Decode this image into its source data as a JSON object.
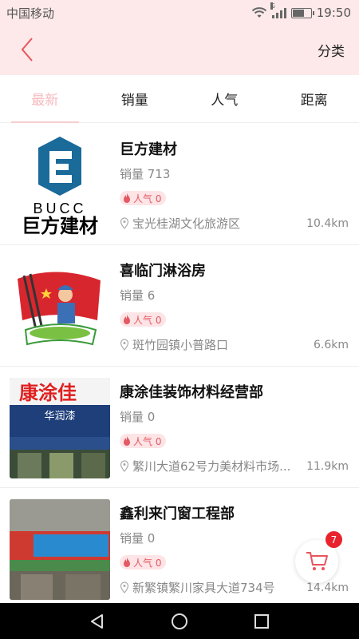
{
  "status_bar": {
    "carrier": "中国移动",
    "network": "G",
    "time": "19:50",
    "battery_level": 0.7
  },
  "header": {
    "back_icon": "chevron-left-icon",
    "category_label": "分类"
  },
  "tabs": [
    {
      "label": "最新",
      "active": true
    },
    {
      "label": "销量",
      "active": false
    },
    {
      "label": "人气",
      "active": false
    },
    {
      "label": "距离",
      "active": false
    }
  ],
  "shops": [
    {
      "name": "巨方建材",
      "sales": "销量 713",
      "popularity": "人气 0",
      "address": "宝光桂湖文化旅游区",
      "distance": "10.4km",
      "logo_text": "BUCC",
      "logo_subtext": "巨方建材"
    },
    {
      "name": "喜临门淋浴房",
      "sales": "销量 6",
      "popularity": "人气 0",
      "address": "斑竹园镇小普路口",
      "distance": "6.6km"
    },
    {
      "name": "康涂佳装饰材料经营部",
      "sales": "销量 0",
      "popularity": "人气 0",
      "address": "繁川大道62号力美材料市场...",
      "distance": "11.9km",
      "sign_text": "康涂佳",
      "sign_sub": "华润漆"
    },
    {
      "name": "鑫利来门窗工程部",
      "sales": "销量 0",
      "popularity": "人气 0",
      "address": "新繁镇繁川家具大道734号",
      "distance": "14.4km"
    }
  ],
  "cart": {
    "count": "7",
    "icon": "cart-icon"
  },
  "colors": {
    "accent": "#e8232e",
    "header_bg": "#fde9ea",
    "active_tab": "#f6b9bd"
  }
}
